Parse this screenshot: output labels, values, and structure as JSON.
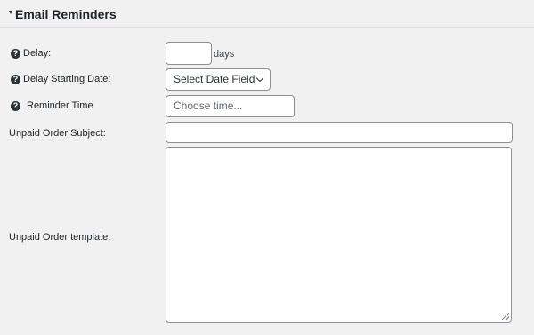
{
  "section": {
    "title": "Email Reminders",
    "toggle_icon": "triangle-down-icon"
  },
  "fields": {
    "delay": {
      "label": "Delay:",
      "value": "",
      "suffix": "days",
      "help_icon": "question-circle-icon"
    },
    "delay_starting_date": {
      "label": "Delay Starting Date:",
      "selected": "Select Date Field",
      "help_icon": "question-circle-icon"
    },
    "reminder_time": {
      "label": "Reminder Time",
      "placeholder": "Choose time...",
      "help_icon": "question-circle-icon"
    },
    "unpaid_order_subject": {
      "label": "Unpaid Order Subject:",
      "value": ""
    },
    "unpaid_order_template": {
      "label": "Unpaid Order template:",
      "value": ""
    }
  },
  "help_glyph": "?"
}
